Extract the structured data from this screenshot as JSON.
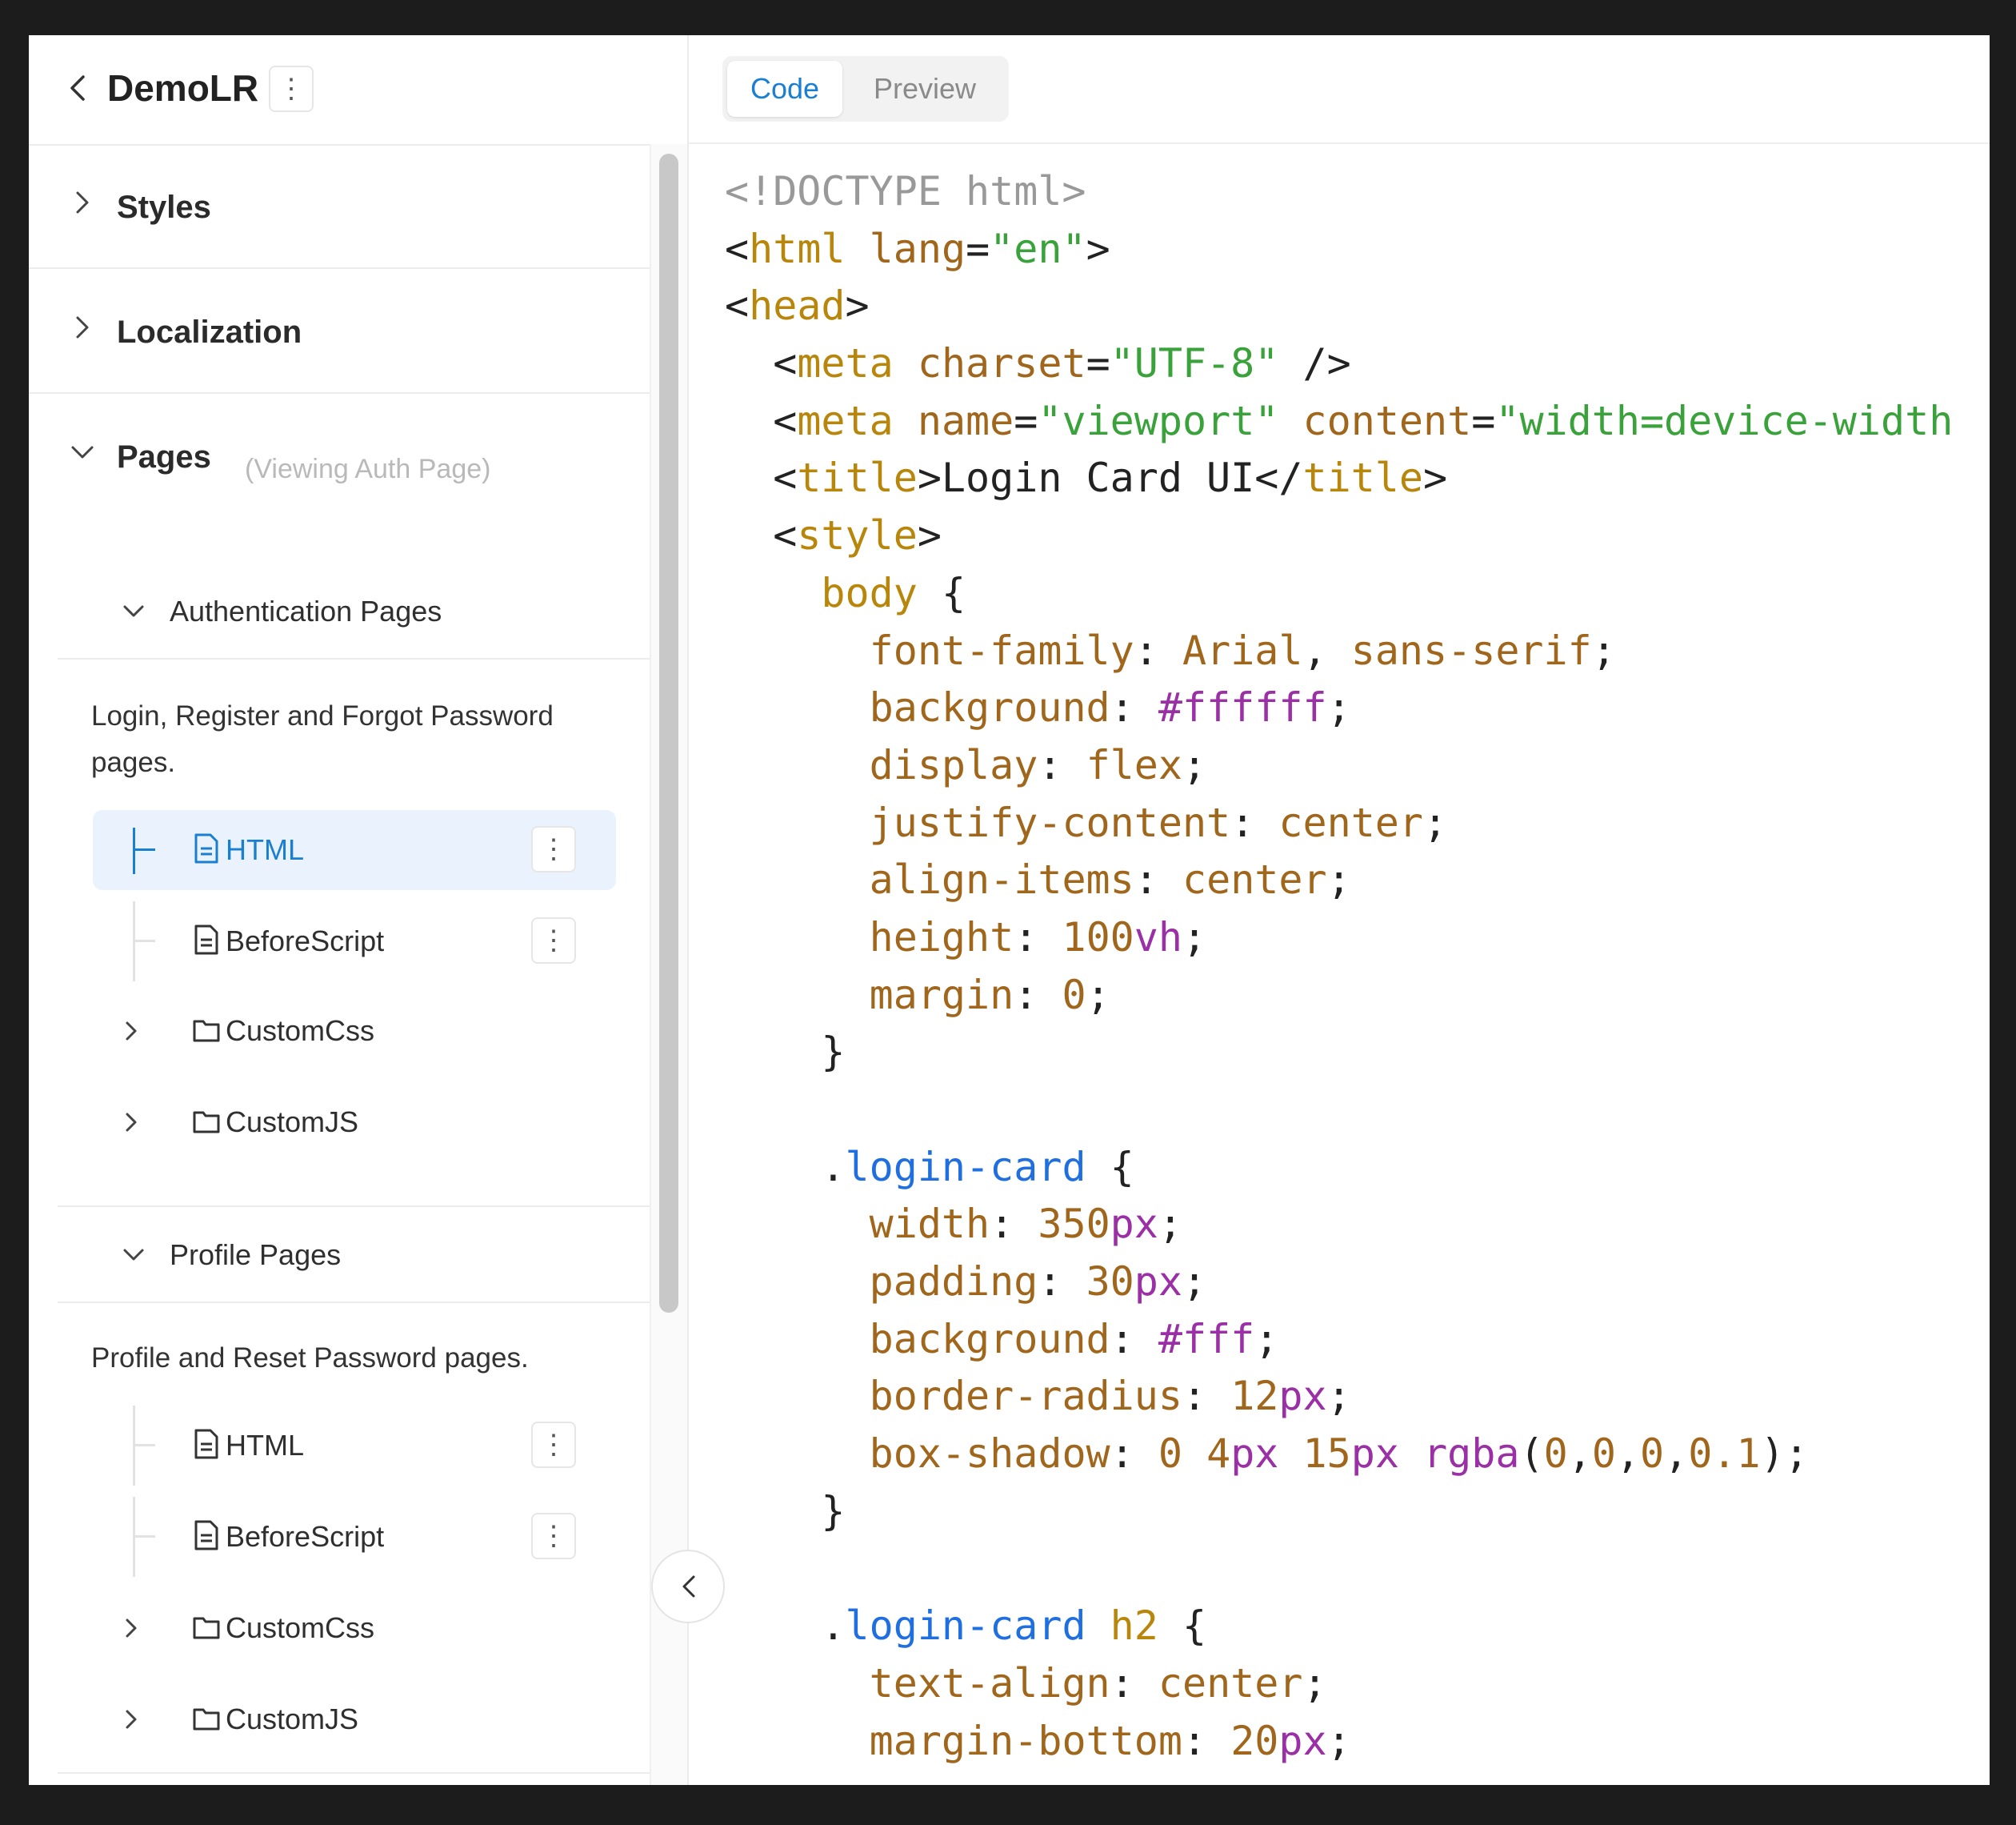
{
  "app": {
    "title": "DemoLR",
    "more_icon": "vertical-dots-icon",
    "back_icon": "chevron-left-icon"
  },
  "sidebar": {
    "sections": [
      {
        "label": "Styles",
        "expanded": false
      },
      {
        "label": "Localization",
        "expanded": false
      },
      {
        "label": "Pages",
        "expanded": true,
        "hint": "(Viewing Auth Page)"
      }
    ],
    "groups": [
      {
        "label": "Authentication Pages",
        "description": "Login, Register and Forgot Password pages.",
        "items": [
          {
            "label": "HTML",
            "type": "file",
            "active": true
          },
          {
            "label": "BeforeScript",
            "type": "file"
          },
          {
            "label": "CustomCss",
            "type": "folder"
          },
          {
            "label": "CustomJS",
            "type": "folder"
          }
        ]
      },
      {
        "label": "Profile Pages",
        "description": "Profile and Reset Password pages.",
        "items": [
          {
            "label": "HTML",
            "type": "file"
          },
          {
            "label": "BeforeScript",
            "type": "file"
          },
          {
            "label": "CustomCss",
            "type": "folder"
          },
          {
            "label": "CustomJS",
            "type": "folder"
          }
        ]
      }
    ]
  },
  "tabs": [
    {
      "label": "Code",
      "active": true
    },
    {
      "label": "Preview",
      "active": false
    }
  ],
  "colors": {
    "accent": "#1a7fd1",
    "active_bg": "#eaf3fd",
    "code_tag": "#b8860b",
    "code_string": "#3aa23a",
    "code_keyword": "#1f6fe0",
    "code_number_unit": "#9b2fa6"
  },
  "code_lines": [
    [
      [
        "c",
        "<!DOCTYPE html>"
      ]
    ],
    [
      [
        "p",
        "<"
      ],
      [
        "t",
        "html"
      ],
      [
        "p",
        " "
      ],
      [
        "a",
        "lang"
      ],
      [
        "p",
        "="
      ],
      [
        "s",
        "\"en\""
      ],
      [
        "p",
        ">"
      ]
    ],
    [
      [
        "p",
        "<"
      ],
      [
        "t",
        "head"
      ],
      [
        "p",
        ">"
      ]
    ],
    [
      [
        "p",
        "  <"
      ],
      [
        "t",
        "meta"
      ],
      [
        "p",
        " "
      ],
      [
        "a",
        "charset"
      ],
      [
        "p",
        "="
      ],
      [
        "s",
        "\"UTF-8\""
      ],
      [
        "p",
        " />"
      ]
    ],
    [
      [
        "p",
        "  <"
      ],
      [
        "t",
        "meta"
      ],
      [
        "p",
        " "
      ],
      [
        "a",
        "name"
      ],
      [
        "p",
        "="
      ],
      [
        "s",
        "\"viewport\""
      ],
      [
        "p",
        " "
      ],
      [
        "a",
        "content"
      ],
      [
        "p",
        "="
      ],
      [
        "s",
        "\"width=device-width"
      ]
    ],
    [
      [
        "p",
        "  <"
      ],
      [
        "t",
        "title"
      ],
      [
        "p",
        ">Login Card UI</"
      ],
      [
        "t",
        "title"
      ],
      [
        "p",
        ">"
      ]
    ],
    [
      [
        "p",
        "  <"
      ],
      [
        "t",
        "style"
      ],
      [
        "p",
        ">"
      ]
    ],
    [
      [
        "p",
        "    "
      ],
      [
        "t",
        "body"
      ],
      [
        "p",
        " {"
      ]
    ],
    [
      [
        "p",
        "      "
      ],
      [
        "a",
        "font-family"
      ],
      [
        "p",
        ": "
      ],
      [
        "v",
        "Arial"
      ],
      [
        "p",
        ", "
      ],
      [
        "v",
        "sans-serif"
      ],
      [
        "p",
        ";"
      ]
    ],
    [
      [
        "p",
        "      "
      ],
      [
        "a",
        "background"
      ],
      [
        "p",
        ": "
      ],
      [
        "n",
        "#ffffff"
      ],
      [
        "p",
        ";"
      ]
    ],
    [
      [
        "p",
        "      "
      ],
      [
        "a",
        "display"
      ],
      [
        "p",
        ": "
      ],
      [
        "v",
        "flex"
      ],
      [
        "p",
        ";"
      ]
    ],
    [
      [
        "p",
        "      "
      ],
      [
        "a",
        "justify-content"
      ],
      [
        "p",
        ": "
      ],
      [
        "v",
        "center"
      ],
      [
        "p",
        ";"
      ]
    ],
    [
      [
        "p",
        "      "
      ],
      [
        "a",
        "align-items"
      ],
      [
        "p",
        ": "
      ],
      [
        "v",
        "center"
      ],
      [
        "p",
        ";"
      ]
    ],
    [
      [
        "p",
        "      "
      ],
      [
        "a",
        "height"
      ],
      [
        "p",
        ": "
      ],
      [
        "v",
        "100"
      ],
      [
        "n",
        "vh"
      ],
      [
        "p",
        ";"
      ]
    ],
    [
      [
        "p",
        "      "
      ],
      [
        "a",
        "margin"
      ],
      [
        "p",
        ": "
      ],
      [
        "v",
        "0"
      ],
      [
        "p",
        ";"
      ]
    ],
    [
      [
        "p",
        "    }"
      ]
    ],
    [
      [
        "p",
        ""
      ]
    ],
    [
      [
        "p",
        "    ."
      ],
      [
        "k",
        "login-card"
      ],
      [
        "p",
        " {"
      ]
    ],
    [
      [
        "p",
        "      "
      ],
      [
        "a",
        "width"
      ],
      [
        "p",
        ": "
      ],
      [
        "v",
        "350"
      ],
      [
        "n",
        "px"
      ],
      [
        "p",
        ";"
      ]
    ],
    [
      [
        "p",
        "      "
      ],
      [
        "a",
        "padding"
      ],
      [
        "p",
        ": "
      ],
      [
        "v",
        "30"
      ],
      [
        "n",
        "px"
      ],
      [
        "p",
        ";"
      ]
    ],
    [
      [
        "p",
        "      "
      ],
      [
        "a",
        "background"
      ],
      [
        "p",
        ": "
      ],
      [
        "n",
        "#fff"
      ],
      [
        "p",
        ";"
      ]
    ],
    [
      [
        "p",
        "      "
      ],
      [
        "a",
        "border-radius"
      ],
      [
        "p",
        ": "
      ],
      [
        "v",
        "12"
      ],
      [
        "n",
        "px"
      ],
      [
        "p",
        ";"
      ]
    ],
    [
      [
        "p",
        "      "
      ],
      [
        "a",
        "box-shadow"
      ],
      [
        "p",
        ": "
      ],
      [
        "v",
        "0"
      ],
      [
        "p",
        " "
      ],
      [
        "v",
        "4"
      ],
      [
        "n",
        "px"
      ],
      [
        "p",
        " "
      ],
      [
        "v",
        "15"
      ],
      [
        "n",
        "px"
      ],
      [
        "p",
        " "
      ],
      [
        "n",
        "rgba"
      ],
      [
        "p",
        "("
      ],
      [
        "v",
        "0"
      ],
      [
        "p",
        ","
      ],
      [
        "v",
        "0"
      ],
      [
        "p",
        ","
      ],
      [
        "v",
        "0"
      ],
      [
        "p",
        ","
      ],
      [
        "v",
        "0.1"
      ],
      [
        "p",
        ");"
      ]
    ],
    [
      [
        "p",
        "    }"
      ]
    ],
    [
      [
        "p",
        ""
      ]
    ],
    [
      [
        "p",
        "    ."
      ],
      [
        "k",
        "login-card"
      ],
      [
        "p",
        " "
      ],
      [
        "t",
        "h2"
      ],
      [
        "p",
        " {"
      ]
    ],
    [
      [
        "p",
        "      "
      ],
      [
        "a",
        "text-align"
      ],
      [
        "p",
        ": "
      ],
      [
        "v",
        "center"
      ],
      [
        "p",
        ";"
      ]
    ],
    [
      [
        "p",
        "      "
      ],
      [
        "a",
        "margin-bottom"
      ],
      [
        "p",
        ": "
      ],
      [
        "v",
        "20"
      ],
      [
        "n",
        "px"
      ],
      [
        "p",
        ";"
      ]
    ]
  ]
}
